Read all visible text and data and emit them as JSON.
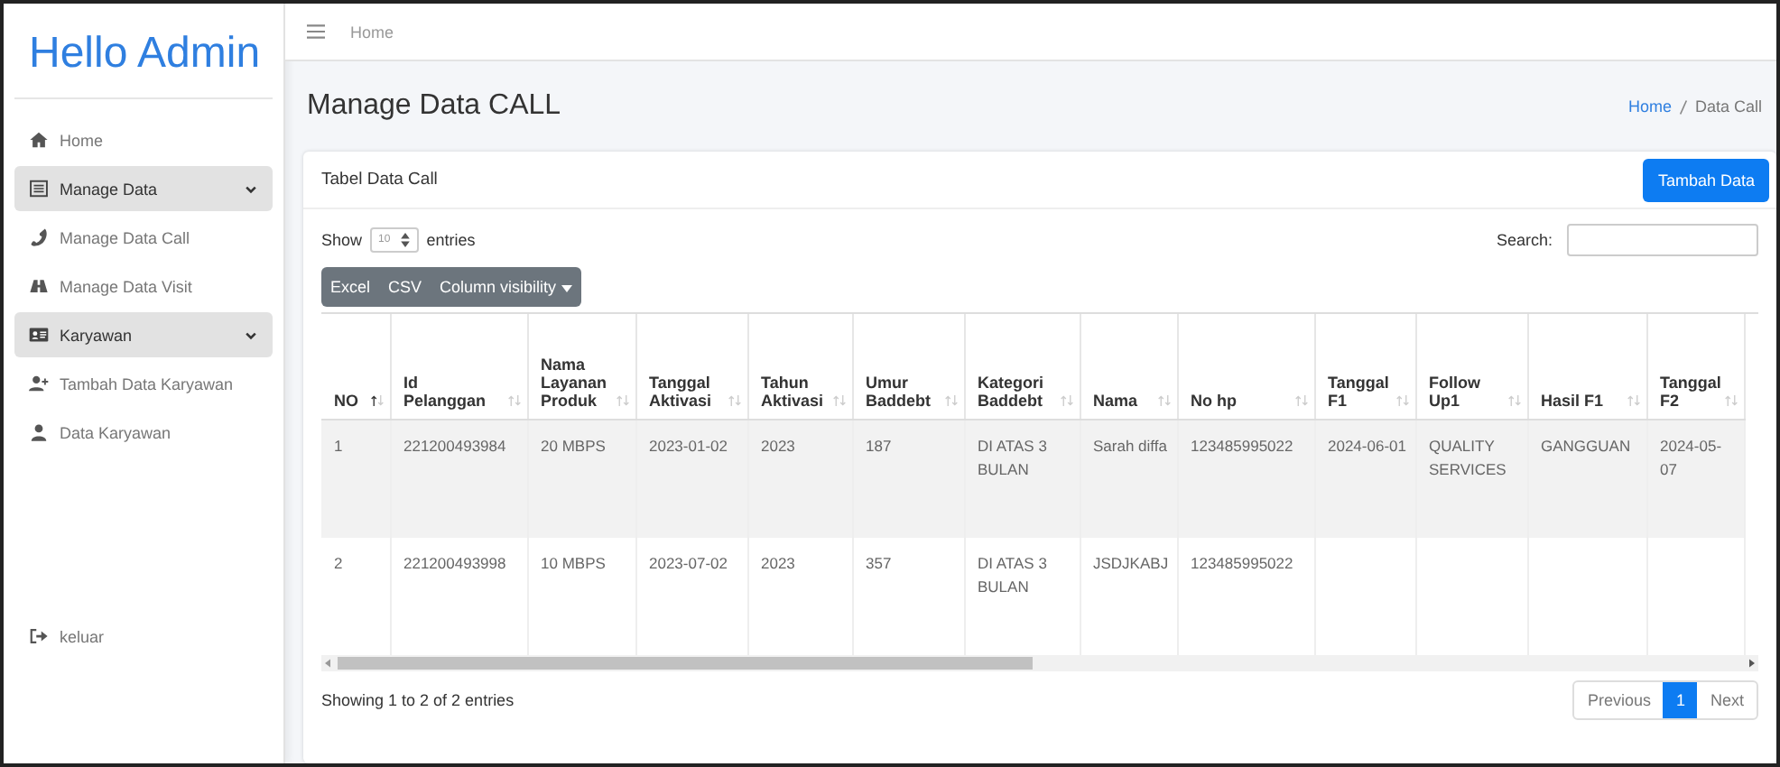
{
  "sidebar": {
    "brand": "Hello Admin",
    "items": [
      {
        "label": "Home",
        "kind": "link"
      },
      {
        "label": "Manage Data",
        "kind": "group",
        "expanded": true
      },
      {
        "label": "Manage Data Call",
        "kind": "link"
      },
      {
        "label": "Manage Data Visit",
        "kind": "link"
      },
      {
        "label": "Karyawan",
        "kind": "group",
        "expanded": true
      },
      {
        "label": "Tambah Data Karyawan",
        "kind": "link"
      },
      {
        "label": "Data Karyawan",
        "kind": "link"
      }
    ],
    "logout": "keluar"
  },
  "navbar": {
    "link": "Home"
  },
  "page": {
    "title": "Manage Data CALL",
    "breadcrumb": [
      "Home",
      "Data Call"
    ]
  },
  "card": {
    "title": "Tabel Data Call",
    "add_button": "Tambah Data",
    "length": {
      "before": "Show",
      "value": "10",
      "after": "entries"
    },
    "search": {
      "label": "Search:"
    },
    "export_buttons": [
      "Excel",
      "CSV",
      "Column visibility"
    ],
    "columns": [
      {
        "label": "NO",
        "sorted": true
      },
      {
        "label": "Id Pelanggan",
        "sorted": false
      },
      {
        "label": "Nama Layanan Produk",
        "sorted": false
      },
      {
        "label": "Tanggal Aktivasi",
        "sorted": false
      },
      {
        "label": "Tahun Aktivasi",
        "sorted": false
      },
      {
        "label": "Umur Baddebt",
        "sorted": false
      },
      {
        "label": "Kategori Baddebt",
        "sorted": false
      },
      {
        "label": "Nama",
        "sorted": false
      },
      {
        "label": "No hp",
        "sorted": false
      },
      {
        "label": "Tanggal F1",
        "sorted": false
      },
      {
        "label": "Follow Up1",
        "sorted": false
      },
      {
        "label": "Hasil F1",
        "sorted": false
      },
      {
        "label": "Tanggal F2",
        "sorted": false
      }
    ],
    "rows": [
      {
        "cells": [
          "1",
          "221200493984",
          "20 MBPS",
          "2023-01-02",
          "2023",
          "187",
          "DI ATAS 3 BULAN",
          "Sarah diffa",
          "123485995022",
          "2024-06-01",
          "QUALITY SERVICES",
          "GANGGUAN",
          "2024-05-07"
        ]
      },
      {
        "cells": [
          "2",
          "221200493998",
          "10 MBPS",
          "2023-07-02",
          "2023",
          "357",
          "DI ATAS 3 BULAN",
          "JSDJKABJ",
          "123485995022"
        ]
      }
    ],
    "info": "Showing 1 to 2 of 2 entries",
    "pagination": [
      {
        "label": "Previous",
        "selected": false
      },
      {
        "label": "1",
        "selected": true
      },
      {
        "label": "Next",
        "selected": false
      }
    ]
  }
}
